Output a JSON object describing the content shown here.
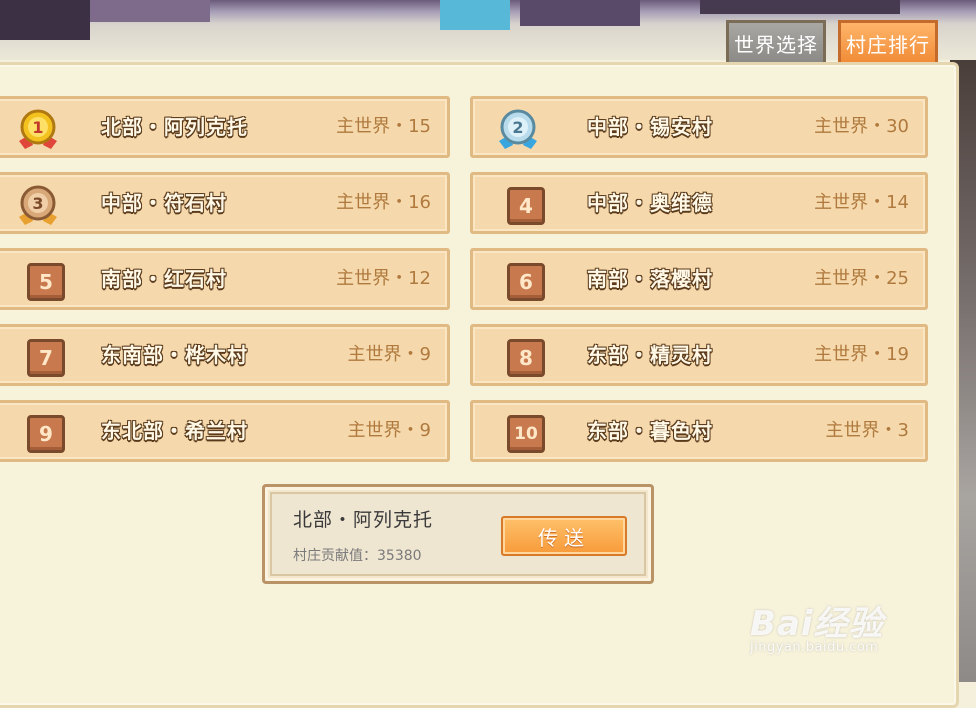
{
  "tabs": [
    {
      "label": "世界选择",
      "active": false
    },
    {
      "label": "村庄排行",
      "active": true
    }
  ],
  "rankings": [
    {
      "rank": "1",
      "name": "北部・阿列克托",
      "world": "主世界・15",
      "badge": "gold-medal"
    },
    {
      "rank": "2",
      "name": "中部・锡安村",
      "world": "主世界・30",
      "badge": "silver-medal"
    },
    {
      "rank": "3",
      "name": "中部・符石村",
      "world": "主世界・16",
      "badge": "bronze-medal"
    },
    {
      "rank": "4",
      "name": "中部・奥维德",
      "world": "主世界・14",
      "badge": "number"
    },
    {
      "rank": "5",
      "name": "南部・红石村",
      "world": "主世界・12",
      "badge": "number"
    },
    {
      "rank": "6",
      "name": "南部・落樱村",
      "world": "主世界・25",
      "badge": "number"
    },
    {
      "rank": "7",
      "name": "东南部・桦木村",
      "world": "主世界・9",
      "badge": "number"
    },
    {
      "rank": "8",
      "name": "东部・精灵村",
      "world": "主世界・19",
      "badge": "number"
    },
    {
      "rank": "9",
      "name": "东北部・希兰村",
      "world": "主世界・9",
      "badge": "number"
    },
    {
      "rank": "10",
      "name": "东部・暮色村",
      "world": "主世界・3",
      "badge": "number"
    }
  ],
  "selected": {
    "name": "北部・阿列克托",
    "contribution": "村庄贡献值：35380",
    "button_label": "传送"
  },
  "watermark": {
    "main": "Bai经验",
    "sub": "jingyan.baidu.com"
  },
  "colors": {
    "row_bg": "#f5d9ac",
    "accent_orange": "#f79a3a",
    "badge_brown": "#c87a4e",
    "gold": "#f4c21e",
    "silver": "#7fc6e8",
    "bronze": "#d9a878"
  }
}
